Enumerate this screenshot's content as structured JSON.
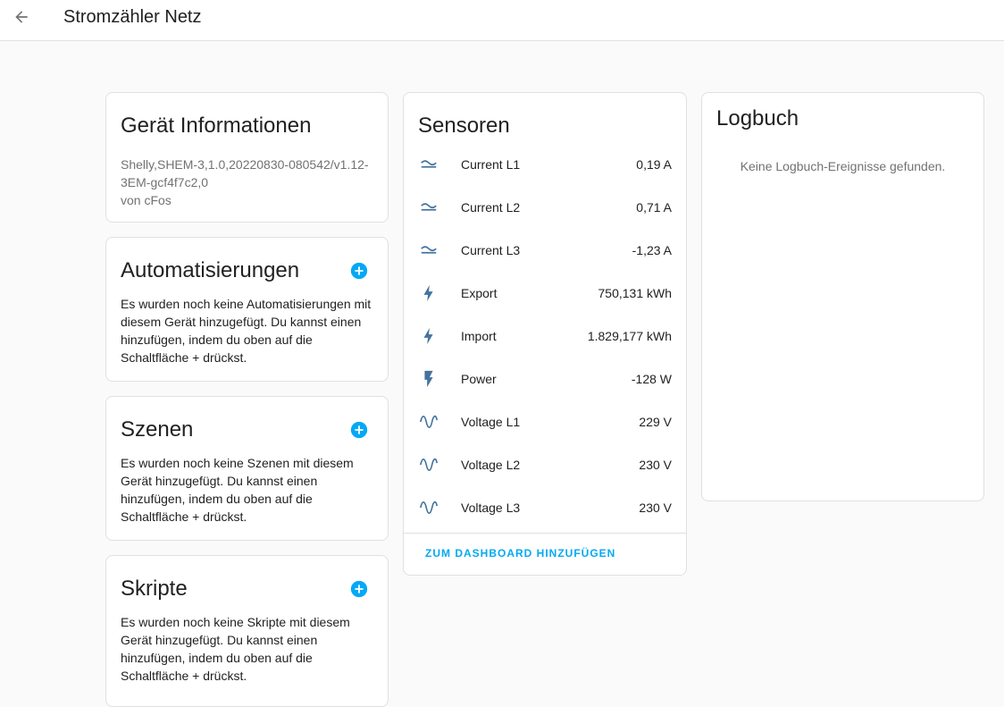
{
  "header": {
    "title": "Stromzähler Netz"
  },
  "device_info": {
    "title": "Gerät Informationen",
    "model_line1": "Shelly,SHEM-3,1.0,20220830-080542/v1.12-",
    "model_line2": "3EM-gcf4f7c2,0",
    "manufacturer": "von cFos"
  },
  "automations": {
    "title": "Automatisierungen",
    "lines": [
      "Es wurden noch keine Automatisierungen mit",
      "diesem Gerät hinzugefügt. Du kannst einen",
      "hinzufügen, indem du oben auf die",
      "Schaltfläche + drückst."
    ]
  },
  "scenes": {
    "title": "Szenen",
    "lines": [
      "Es wurden noch keine Szenen mit diesem",
      "Gerät hinzugefügt. Du kannst einen",
      "hinzufügen, indem du oben auf die",
      "Schaltfläche + drückst."
    ]
  },
  "scripts": {
    "title": "Skripte",
    "lines": [
      "Es wurden noch keine Skripte mit diesem",
      "Gerät hinzugefügt. Du kannst einen",
      "hinzufügen, indem du oben auf die",
      "Schaltfläche + drückst."
    ]
  },
  "sensors": {
    "title": "Sensoren",
    "items": [
      {
        "icon": "current-ac-icon",
        "name": "Current L1",
        "value": "0,19 A"
      },
      {
        "icon": "current-ac-icon",
        "name": "Current L2",
        "value": "0,71 A"
      },
      {
        "icon": "current-ac-icon",
        "name": "Current L3",
        "value": "-1,23 A"
      },
      {
        "icon": "lightning-bolt-icon",
        "name": "Export",
        "value": "750,131 kWh"
      },
      {
        "icon": "lightning-bolt-icon",
        "name": "Import",
        "value": "1.829,177 kWh"
      },
      {
        "icon": "flash-icon",
        "name": "Power",
        "value": "-128 W"
      },
      {
        "icon": "sine-wave-icon",
        "name": "Voltage L1",
        "value": "229 V"
      },
      {
        "icon": "sine-wave-icon",
        "name": "Voltage L2",
        "value": "230 V"
      },
      {
        "icon": "sine-wave-icon",
        "name": "Voltage L3",
        "value": "230 V"
      }
    ],
    "add_to_dashboard": "ZUM DASHBOARD HINZUFÜGEN"
  },
  "logbook": {
    "title": "Logbuch",
    "empty_text": "Keine Logbuch-Ereignisse gefunden."
  },
  "colors": {
    "accent": "#03a9f4",
    "icon": "#44739e"
  }
}
